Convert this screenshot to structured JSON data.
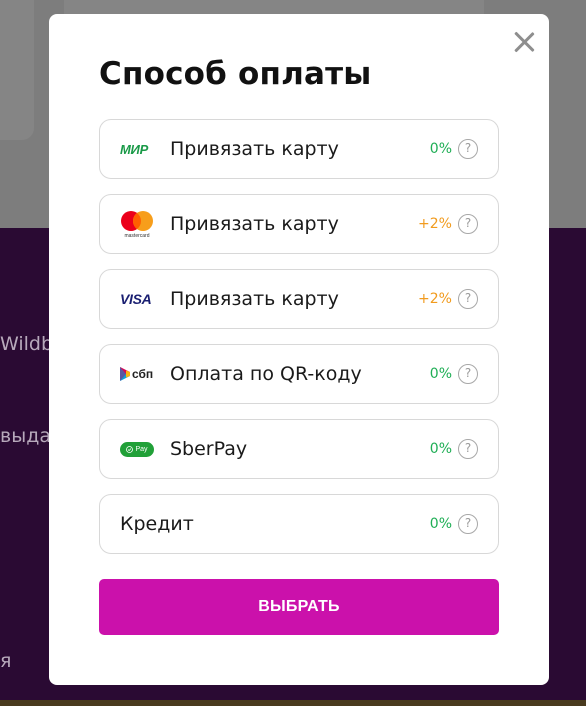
{
  "background": {
    "text_1": "Wildbe",
    "text_2": "выдач",
    "text_3": "я"
  },
  "modal": {
    "title": "Способ оплаты",
    "methods": [
      {
        "logo": "mir-logo",
        "logo_text": "МИР",
        "label": "Привязать карту",
        "fee": "0%",
        "fee_color": "#1fae55"
      },
      {
        "logo": "mastercard-logo",
        "logo_text": "mastercard",
        "label": "Привязать карту",
        "fee": "+2%",
        "fee_color": "#f19b1e"
      },
      {
        "logo": "visa-logo",
        "logo_text": "VISA",
        "label": "Привязать карту",
        "fee": "+2%",
        "fee_color": "#f19b1e"
      },
      {
        "logo": "sbp-logo",
        "logo_text": "сбп",
        "label": "Оплата по QR-коду",
        "fee": "0%",
        "fee_color": "#1fae55"
      },
      {
        "logo": "sberpay-logo",
        "logo_text": "Pay",
        "label": "SberPay",
        "fee": "0%",
        "fee_color": "#1fae55"
      },
      {
        "logo": "",
        "logo_text": "",
        "label": "Кредит",
        "fee": "0%",
        "fee_color": "#1fae55"
      }
    ],
    "help_symbol": "?",
    "select_label": "ВЫБРАТЬ"
  },
  "colors": {
    "accent": "#cb11ab",
    "fee_green": "#1fae55",
    "fee_orange": "#f19b1e"
  }
}
